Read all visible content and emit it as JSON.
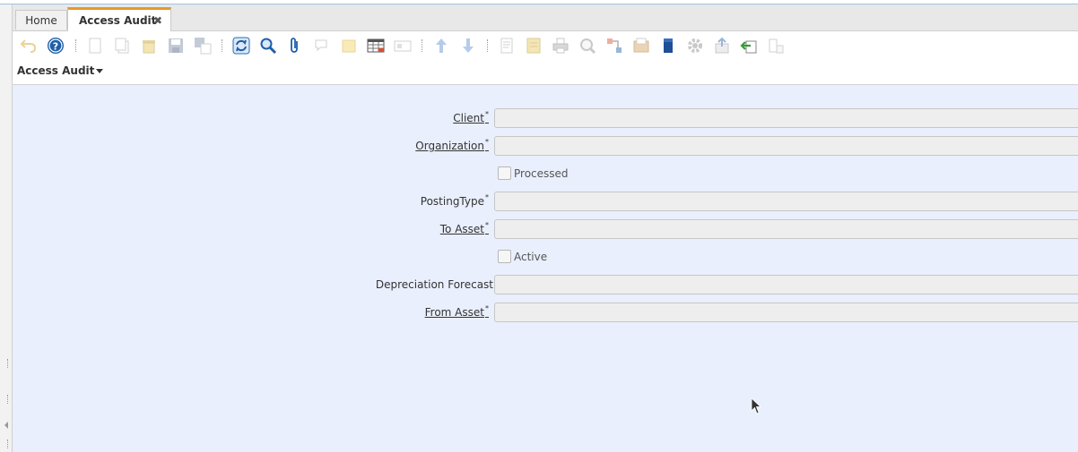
{
  "tabs": {
    "home": "Home",
    "active": "Access Audit",
    "close_glyph": "✖"
  },
  "toolbar": [
    {
      "icon": "undo-icon",
      "enabled": false
    },
    {
      "icon": "help-icon",
      "enabled": true
    },
    {
      "icon": "new-record-icon",
      "enabled": false
    },
    {
      "icon": "copy-record-icon",
      "enabled": false
    },
    {
      "icon": "delete-icon",
      "enabled": false
    },
    {
      "icon": "save-icon",
      "enabled": false
    },
    {
      "icon": "save-new-icon",
      "enabled": false
    },
    {
      "icon": "refresh-icon",
      "enabled": true
    },
    {
      "icon": "find-icon",
      "enabled": true
    },
    {
      "icon": "attachment-icon",
      "enabled": true
    },
    {
      "icon": "chat-icon",
      "enabled": false
    },
    {
      "icon": "post-it-icon",
      "enabled": false
    },
    {
      "icon": "grid-toggle-icon",
      "enabled": true
    },
    {
      "icon": "multi-edit-icon",
      "enabled": false
    },
    {
      "icon": "parent-record-icon",
      "enabled": false
    },
    {
      "icon": "detail-record-icon",
      "enabled": false
    },
    {
      "icon": "report-icon",
      "enabled": false
    },
    {
      "icon": "archive-icon",
      "enabled": false
    },
    {
      "icon": "print-icon",
      "enabled": false
    },
    {
      "icon": "zoom-across-icon",
      "enabled": false
    },
    {
      "icon": "active-workflows-icon",
      "enabled": false
    },
    {
      "icon": "requests-icon",
      "enabled": false
    },
    {
      "icon": "product-info-icon",
      "enabled": true
    },
    {
      "icon": "process-gear-icon",
      "enabled": false
    },
    {
      "icon": "export-icon",
      "enabled": false
    },
    {
      "icon": "import-icon",
      "enabled": true
    },
    {
      "icon": "customize-icon",
      "enabled": false
    }
  ],
  "breadcrumb": "Access Audit",
  "form": {
    "client_label": "Client",
    "organization_label": "Organization",
    "processed_label": "Processed",
    "posting_type_label": "PostingType",
    "to_asset_label": "To Asset",
    "active_label": "Active",
    "depreciation_forecast_label": "Depreciation Forecast",
    "from_asset_label": "From Asset",
    "mandatory_marker": "*"
  },
  "colors": {
    "accent": "#e49b25",
    "form_bg": "#e9effc",
    "icon_blue": "#1f5fa8"
  }
}
